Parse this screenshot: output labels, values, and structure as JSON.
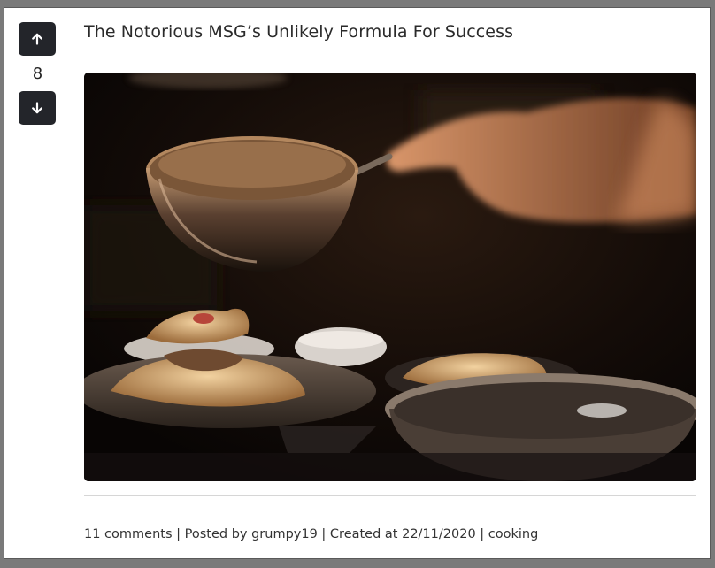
{
  "post": {
    "title": "The Notorious MSG’s Unlikely Formula For Success",
    "score": "8",
    "comments_link": "11 comments",
    "posted_by": "Posted by grumpy19",
    "created_at": "Created at 22/11/2020",
    "category": "cooking",
    "separator": " | "
  },
  "vote": {
    "up_icon": "arrow-up-icon",
    "down_icon": "arrow-down-icon"
  },
  "image": {
    "subject": "chef-pouring-sauce-photo"
  },
  "colors": {
    "button_bg": "#23252a",
    "text": "#2a2a2a"
  }
}
